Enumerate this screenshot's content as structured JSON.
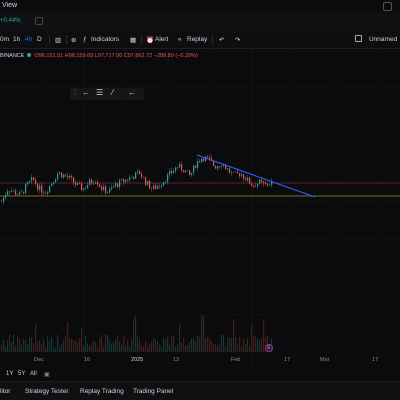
{
  "window": {
    "menu_label": "View"
  },
  "ticker": {
    "change": "+0.44%"
  },
  "toolbar": {
    "intervals": [
      "0m",
      "1h",
      "4h",
      "D"
    ],
    "active_interval": "4h",
    "indicators_label": "Indicators",
    "alert_label": "Alert",
    "replay_label": "Replay",
    "unnamed_label": "Unnamed"
  },
  "legend": {
    "symbol": "BINANCE",
    "open": "O96,151.51",
    "high": "H98,159.69",
    "low": "L97,717.06",
    "close": "C97,862.72",
    "change": "−288.80 (−0.29%)"
  },
  "date_axis": [
    "Dec",
    "16",
    "2025",
    "13",
    "Feb",
    "17",
    "Mar",
    "17"
  ],
  "range_buttons": [
    "1Y",
    "5Y",
    "All"
  ],
  "bottom_tabs": [
    "litor",
    "Strategy Tester",
    "Replay Trading",
    "Trading Panel"
  ],
  "event_badge": "E",
  "colors": {
    "up": "#26a69a",
    "down": "#ef5350",
    "trendline": "#2962ff",
    "support": "#b8a431",
    "background": "#0b0b0d"
  },
  "chart_data": {
    "type": "candlestick",
    "title": "",
    "xlabel": "",
    "ylabel": "",
    "x_ticks": [
      "Dec",
      "16",
      "2025",
      "13",
      "Feb",
      "17",
      "Mar",
      "17"
    ],
    "price_path": [
      92,
      96,
      95,
      94,
      97,
      99,
      96,
      95,
      98,
      101,
      100,
      99,
      97,
      96,
      98,
      99,
      96,
      95,
      97,
      98,
      99,
      100,
      101,
      98,
      96,
      97,
      99,
      101,
      103,
      102,
      100,
      104,
      106,
      105,
      103,
      104,
      102,
      100,
      101,
      99,
      97,
      98,
      97,
      98
    ],
    "annotations": [
      {
        "type": "trendline",
        "start_index": 27,
        "end_index": 56
      },
      {
        "type": "horizontal_line",
        "level": 95
      }
    ]
  }
}
